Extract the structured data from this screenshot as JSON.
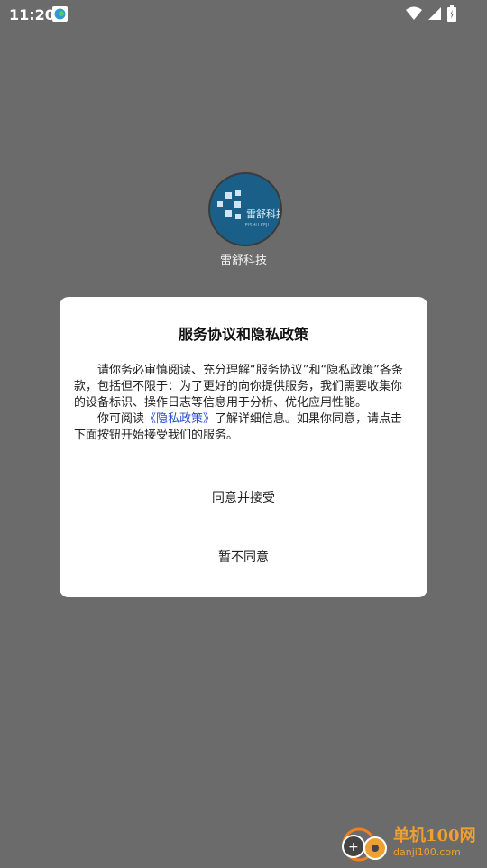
{
  "status_bar": {
    "time": "11:20",
    "icons": [
      "app-notification-icon",
      "wifi-icon",
      "signal-icon",
      "battery-icon"
    ]
  },
  "app": {
    "name": "雷舒科技",
    "logo_text": "雷舒科技"
  },
  "dialog": {
    "title": "服务协议和隐私政策",
    "paragraph1": "请你务必审慎阅读、充分理解“服务协议”和“隐私政策”各条款，包括但不限于：为了更好的向你提供服务，我们需要收集你的设备标识、操作日志等信息用于分析、优化应用性能。",
    "paragraph2_prefix": "你可阅读",
    "paragraph2_link": "《隐私政策》",
    "paragraph2_suffix": "了解详细信息。如果你同意，请点击下面按钮开始接受我们的服务。",
    "agree_label": "同意并接受",
    "decline_label": "暂不同意"
  },
  "watermark": {
    "brand": "单机100网",
    "domain": "danji100.com"
  },
  "colors": {
    "overlay": "#6b6b6b",
    "dialog_bg": "#ffffff",
    "link": "#2a4fd0",
    "logo_bg": "#1a5f88",
    "watermark": "#f0a030"
  }
}
